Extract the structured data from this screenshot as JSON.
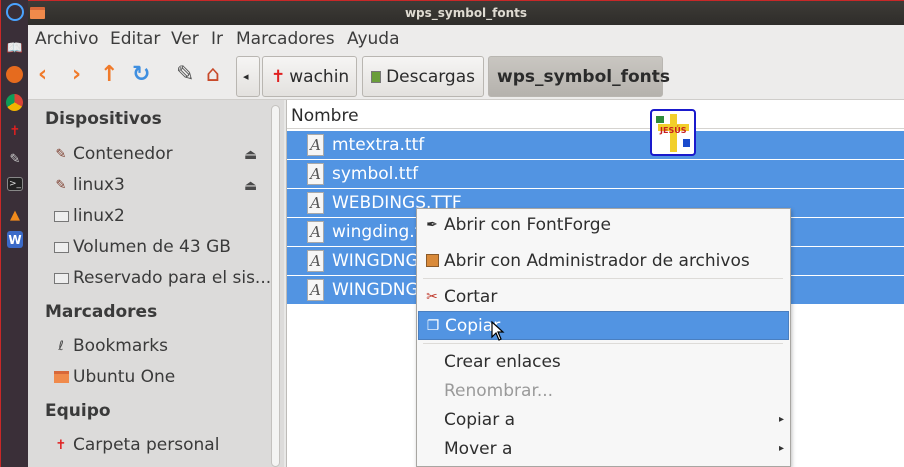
{
  "window": {
    "title": "wps_symbol_fonts"
  },
  "menubar": [
    "Archivo",
    "Editar",
    "Ver",
    "Ir",
    "Marcadores",
    "Ayuda"
  ],
  "toolbar": {
    "back_icon": "chevron-left-icon",
    "forward_icon": "chevron-right-icon",
    "up_icon": "arrow-up-icon",
    "reload_icon": "reload-icon",
    "edit_icon": "pencil-icon",
    "home_icon": "home-icon",
    "breadcrumb": [
      {
        "label": "wachin",
        "icon": "cross-icon"
      },
      {
        "label": "Descargas",
        "icon": "downloads-folder-icon"
      },
      {
        "label": "wps_symbol_fonts",
        "active": true
      }
    ]
  },
  "sidebar": {
    "sections": [
      {
        "title": "Dispositivos",
        "items": [
          {
            "label": "Contenedor",
            "icon": "usb-drive-icon",
            "eject": true
          },
          {
            "label": "linux3",
            "icon": "usb-drive-icon",
            "eject": true
          },
          {
            "label": "linux2",
            "icon": "hard-drive-icon"
          },
          {
            "label": "Volumen de 43 GB",
            "icon": "hard-drive-icon"
          },
          {
            "label": "Reservado para el sis...",
            "icon": "hard-drive-icon"
          }
        ]
      },
      {
        "title": "Marcadores",
        "items": [
          {
            "label": "Bookmarks",
            "icon": "bookmark-leaf-icon"
          },
          {
            "label": "Ubuntu One",
            "icon": "folder-icon"
          }
        ]
      },
      {
        "title": "Equipo",
        "items": [
          {
            "label": "Carpeta personal",
            "icon": "cross-icon"
          }
        ]
      }
    ]
  },
  "files": {
    "column_header": "Nombre",
    "rows": [
      {
        "name": "mtextra.ttf",
        "selected": true
      },
      {
        "name": "symbol.ttf",
        "selected": true
      },
      {
        "name": "WEBDINGS.TTF",
        "selected": true
      },
      {
        "name": "wingding.t",
        "selected": true
      },
      {
        "name": "WINGDNG",
        "selected": true
      },
      {
        "name": "WINGDNG",
        "selected": true
      }
    ]
  },
  "drag_icon": {
    "text": "JESÚS"
  },
  "context_menu": {
    "items": [
      {
        "label": "Abrir con FontForge",
        "icon": "fontforge-icon"
      },
      {
        "label": "Abrir con Administrador de archivos",
        "icon": "file-manager-icon"
      },
      {
        "separator": true
      },
      {
        "label": "Cortar",
        "icon": "scissors-icon"
      },
      {
        "label": "Copiar",
        "icon": "copy-icon",
        "highlighted": true
      },
      {
        "separator": true
      },
      {
        "label": "Crear enlaces"
      },
      {
        "label": "Renombrar...",
        "disabled": true
      },
      {
        "label": "Copiar a",
        "submenu": true
      },
      {
        "label": "Mover a",
        "submenu": true
      }
    ]
  },
  "colors": {
    "selection": "#5294e2",
    "titlebar": "#2f2d2a",
    "launcher": "#3a2f38"
  }
}
